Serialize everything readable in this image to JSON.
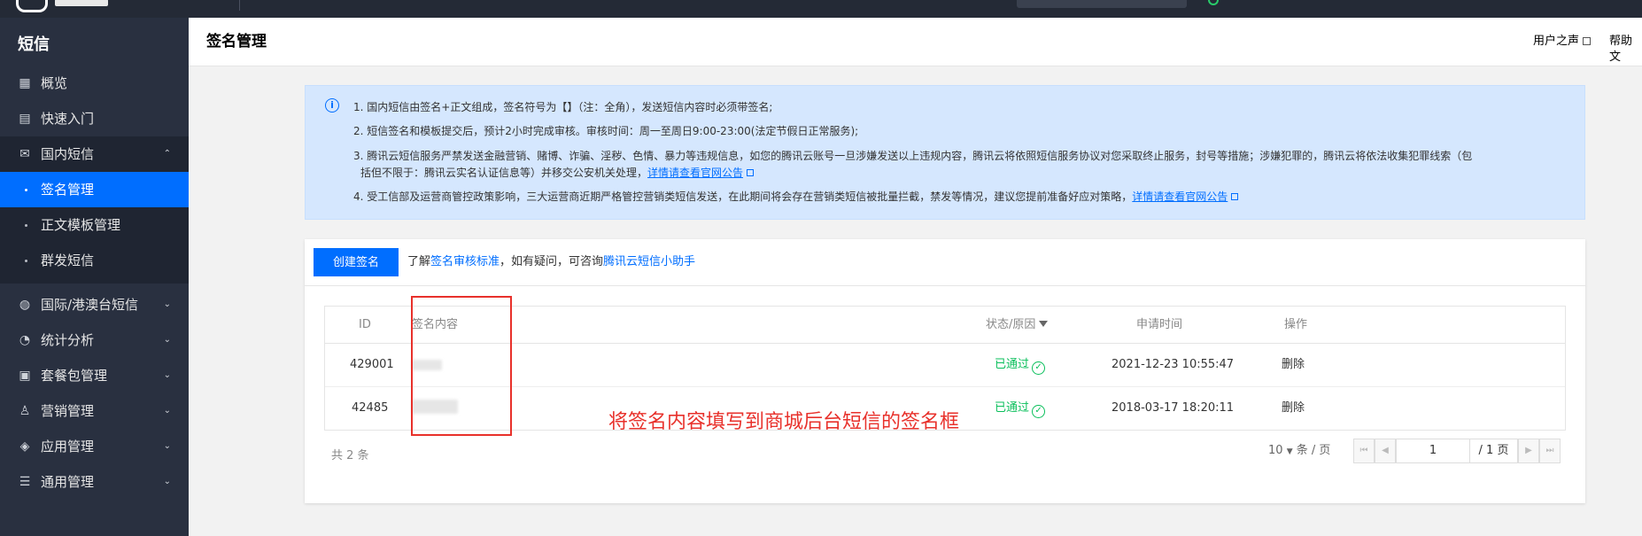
{
  "topbar": {},
  "sidebar": {
    "title": "短信",
    "items": [
      {
        "label": "概览",
        "icon": "grid-icon"
      },
      {
        "label": "快速入门",
        "icon": "book-icon"
      },
      {
        "label": "国内短信",
        "icon": "mail-icon",
        "expanded": true
      },
      {
        "label": "签名管理",
        "active": true
      },
      {
        "label": "正文模板管理"
      },
      {
        "label": "群发短信"
      },
      {
        "label": "国际/港澳台短信",
        "icon": "globe-icon"
      },
      {
        "label": "统计分析",
        "icon": "pie-chart-icon"
      },
      {
        "label": "套餐包管理",
        "icon": "package-icon"
      },
      {
        "label": "营销管理",
        "icon": "user-icon"
      },
      {
        "label": "应用管理",
        "icon": "layers-icon"
      },
      {
        "label": "通用管理",
        "icon": "sliders-icon"
      }
    ]
  },
  "header": {
    "title": "签名管理",
    "links": [
      "用户之声",
      "帮助文"
    ]
  },
  "notice": {
    "lines": [
      "1. 国内短信由签名+正文组成，签名符号为【】（注：全角），发送短信内容时必须带签名;",
      "2. 短信签名和模板提交后，预计2小时完成审核。审核时间：周一至周日9:00-23:00(法定节假日正常服务);",
      "3. 腾讯云短信服务严禁发送金融营销、赌博、诈骗、淫秽、色情、暴力等违规信息，如您的腾讯云账号一旦涉嫌发送以上违规内容，腾讯云将依照短信服务协议对您采取终止服务，封号等措施；涉嫌犯罪的，腾讯云将依法收集犯罪线索（包",
      "括但不限于：腾讯云实名认证信息等）并移交公安机关处理，",
      "4. 受工信部及运营商管控政策影响，三大运营商近期严格管控营销类短信发送，在此期间将会存在营销类短信被批量拦截，禁发等情况，建议您提前准备好应对策略，"
    ],
    "link_text": "详情请查看官网公告"
  },
  "toolbar": {
    "create_label": "创建签名",
    "tip_prefix": "了解",
    "tip_link1": "签名审核标准",
    "tip_middle": "，如有疑问，可咨询",
    "tip_link2": "腾讯云短信小助手"
  },
  "table": {
    "columns": [
      "ID",
      "签名内容",
      "状态/原因",
      "申请时间",
      "操作"
    ],
    "rows": [
      {
        "id": "429001",
        "status": "已通过",
        "time": "2021-12-23 10:55:47",
        "action": "删除"
      },
      {
        "id": "42485",
        "status": "已通过",
        "time": "2018-03-17 18:20:11",
        "action": "删除"
      }
    ]
  },
  "footer": {
    "total": "共 2 条",
    "per_page": "10",
    "per_page_unit": "条 / 页",
    "page": "1",
    "page_total": "/ 1 页"
  },
  "annotation": {
    "text": "将签名内容填写到商城后台短信的签名框",
    "color": "#e8312b"
  },
  "colors": {
    "primary": "#006eff",
    "sidebar": "#293040",
    "success": "#0abf5b"
  }
}
